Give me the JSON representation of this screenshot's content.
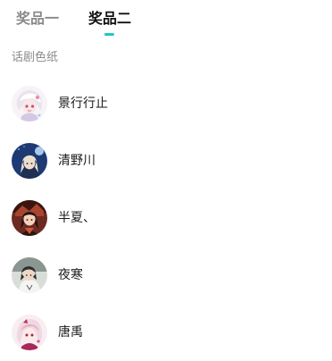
{
  "tabs": [
    {
      "label": "奖品一",
      "active": false
    },
    {
      "label": "奖品二",
      "active": true
    }
  ],
  "accent_color": "#1ec6c4",
  "section": {
    "title": "话剧色纸"
  },
  "winners": [
    {
      "name": "景行行止",
      "avatar": "anime-girl-white-hair-avatar"
    },
    {
      "name": "清野川",
      "avatar": "anime-character-blue-night-avatar"
    },
    {
      "name": "半夏、",
      "avatar": "anime-character-dark-red-avatar"
    },
    {
      "name": "夜寒",
      "avatar": "anime-boy-dark-hair-avatar"
    },
    {
      "name": "唐禹",
      "avatar": "anime-girl-pink-avatar"
    }
  ]
}
